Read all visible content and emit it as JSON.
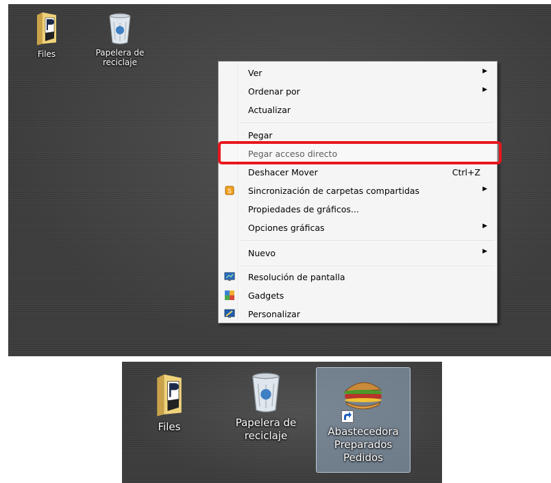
{
  "desktop_top": {
    "icons": [
      {
        "label": "Files"
      },
      {
        "label_line1": "Papelera de",
        "label_line2": "reciclaje"
      }
    ]
  },
  "context_menu": {
    "items": [
      {
        "label": "Ver",
        "submenu": true
      },
      {
        "label": "Ordenar por",
        "submenu": true
      },
      {
        "label": "Actualizar"
      },
      {
        "label": "Pegar"
      },
      {
        "label": "Pegar acceso directo",
        "highlighted": true
      },
      {
        "label": "Deshacer Mover",
        "shortcut": "Ctrl+Z"
      },
      {
        "label": "Sincronización de carpetas compartidas",
        "submenu": true,
        "icon": "sync-icon"
      },
      {
        "label": "Propiedades de gráficos..."
      },
      {
        "label": "Opciones gráficas",
        "submenu": true
      },
      {
        "label": "Nuevo",
        "submenu": true
      },
      {
        "label": "Resolución de pantalla",
        "icon": "monitor-icon"
      },
      {
        "label": "Gadgets",
        "icon": "gadgets-icon"
      },
      {
        "label": "Personalizar",
        "icon": "personalize-icon"
      }
    ],
    "arrow_glyph": "▶",
    "highlight_color": "#e8161e"
  },
  "desktop_bottom": {
    "icons": [
      {
        "label": "Files"
      },
      {
        "label_line1": "Papelera de",
        "label_line2": "reciclaje"
      },
      {
        "label_line1": "Abastecedora",
        "label_line2": "Preparados",
        "label_line3": "Pedidos",
        "selected": true
      }
    ]
  }
}
